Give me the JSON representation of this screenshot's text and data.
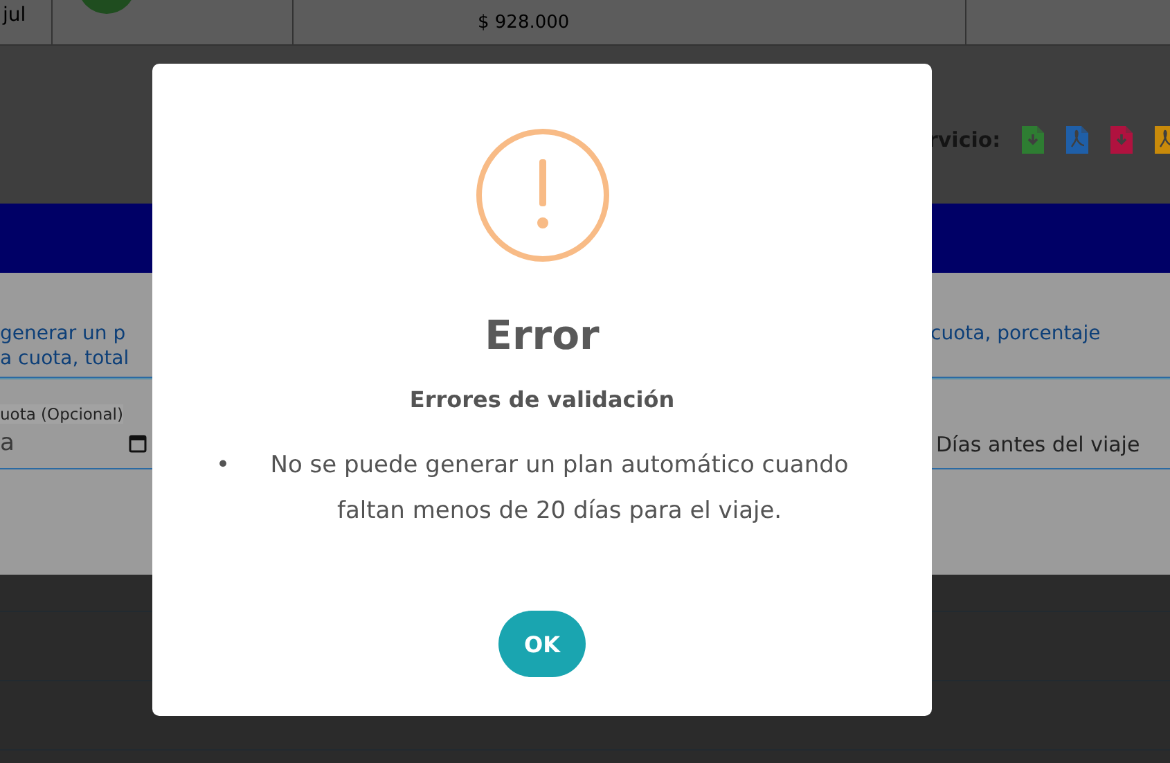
{
  "backdrop": {
    "top_row": {
      "month": "jul",
      "amount": "$ 928.000"
    },
    "service": {
      "label": "rvicio:",
      "files": [
        {
          "kind": "download",
          "color": "#2e7d32"
        },
        {
          "kind": "pdf",
          "color": "#1f5fa8"
        },
        {
          "kind": "download",
          "color": "#b0123f"
        },
        {
          "kind": "pdf",
          "color": "#c98a0a"
        }
      ]
    },
    "notice": {
      "left_lines": [
        "generar un p",
        "a cuota, total"
      ],
      "right_lines": [
        "cuota, porcentaje"
      ]
    },
    "fields": {
      "date_label": "uota (Opcional)",
      "date_placeholder": "a",
      "days_placeholder": "Días antes del viaje"
    }
  },
  "dialog": {
    "title": "Error",
    "subtitle": "Errores de validación",
    "bullet": "•",
    "errors": [
      "No se puede generar un plan automático cuando faltan menos de 20 días para el viaje."
    ],
    "button": "OK"
  }
}
